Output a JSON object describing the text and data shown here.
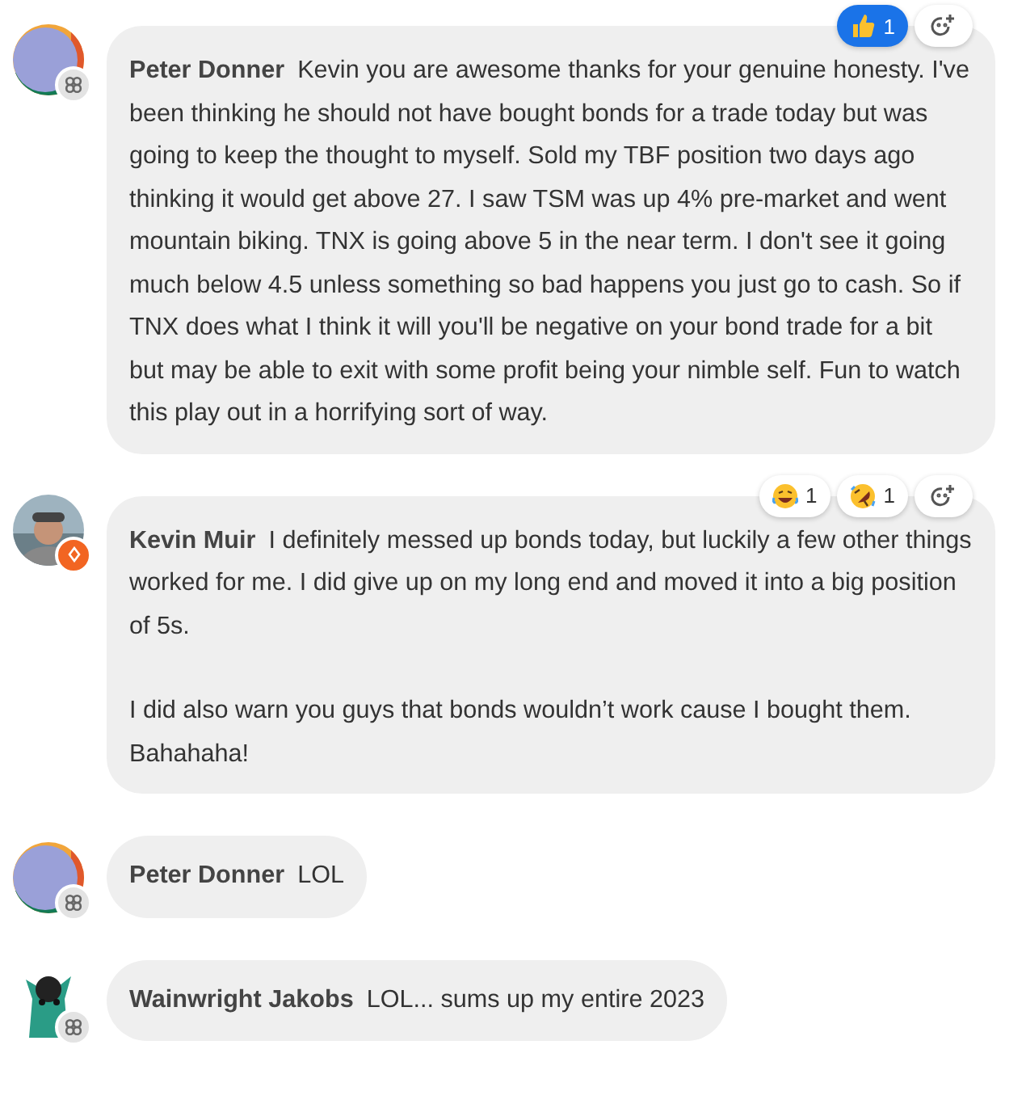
{
  "comments": [
    {
      "author": "Peter Donner",
      "avatar": {
        "kind": "abstract"
      },
      "badge": {
        "kind": "grid"
      },
      "text": "Kevin you are awesome thanks for your genuine honesty. I've been thinking he should not have bought bonds for a trade today but was going to keep the thought to myself. Sold my TBF position two days ago thinking it would get above 27. I saw TSM was up 4% pre-market and went mountain biking. TNX is going above 5 in the near term. I don't see it going much below 4.5 unless something so bad happens you just go to cash. So if TNX does what I think it will you'll be negative on your bond trade for a bit but may be able to exit with some profit being your nimble self. Fun to watch this play out in a horrifying sort of way.",
      "reactions": [
        {
          "kind": "like",
          "count": "1",
          "selected": true
        }
      ]
    },
    {
      "author": "Kevin Muir",
      "badge": {
        "kind": "pen"
      },
      "text": "I definitely messed up bonds today, but luckily a few other things worked for me. I did give up on my long end and moved it into a big position of 5s.\n\nI did also warn you guys that bonds wouldn’t work cause I bought them. Bahahaha!",
      "reactions": [
        {
          "kind": "laugh",
          "count": "1",
          "selected": false
        },
        {
          "kind": "rofl",
          "count": "1",
          "selected": false
        }
      ]
    },
    {
      "author": "Peter Donner",
      "avatar": {
        "kind": "abstract"
      },
      "badge": {
        "kind": "grid"
      },
      "text": "LOL"
    },
    {
      "author": "Wainwright Jakobs",
      "avatar": {
        "kind": "creature"
      },
      "badge": {
        "kind": "grid"
      },
      "text": "LOL... sums up my entire 2023"
    }
  ]
}
